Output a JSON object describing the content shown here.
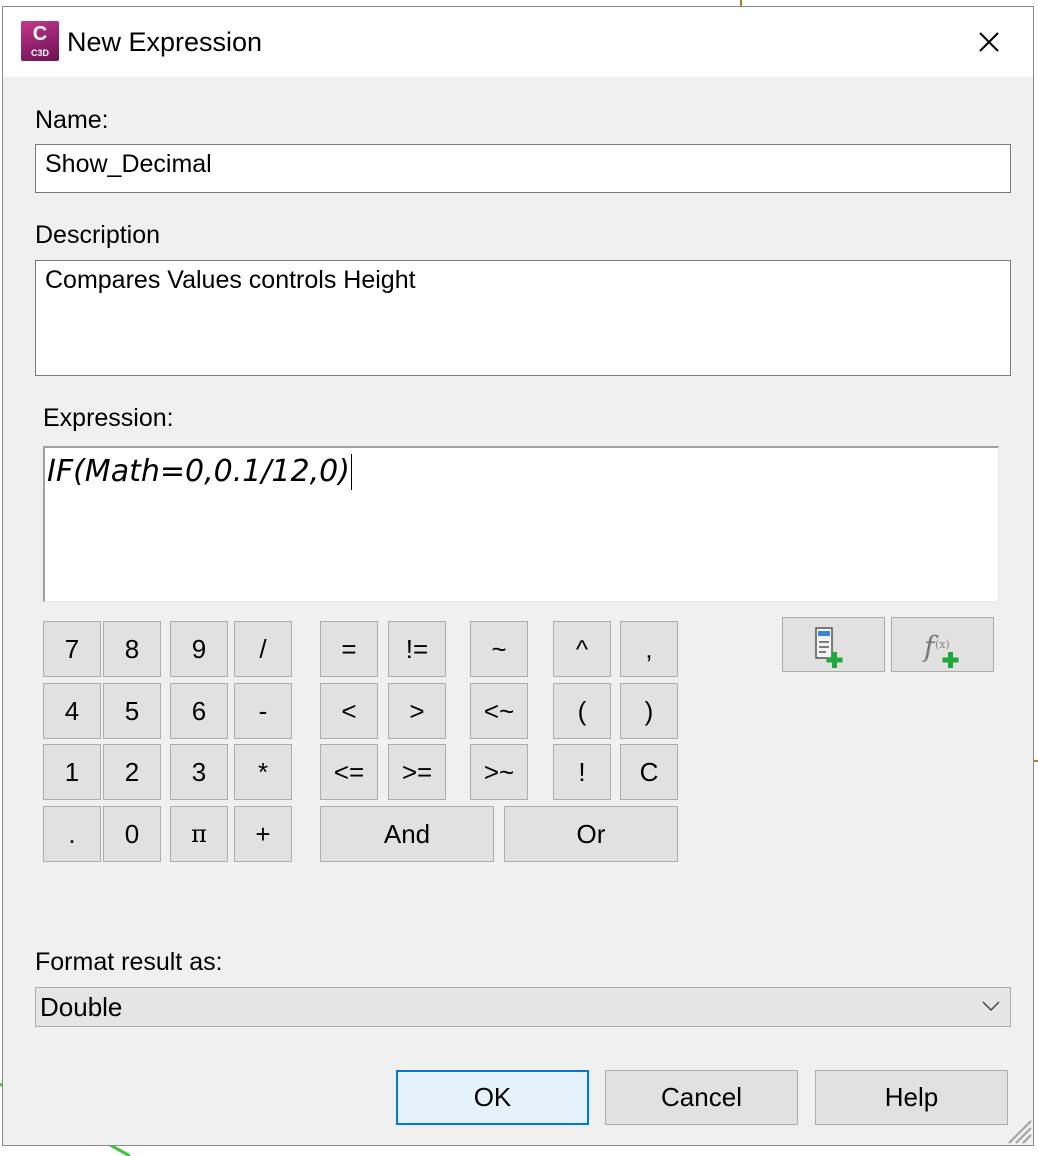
{
  "window": {
    "title": "New Expression",
    "app_icon": {
      "letter": "C",
      "badge": "C3D"
    },
    "close_icon": "close-icon"
  },
  "form": {
    "name_label": "Name:",
    "name_value": "Show_Decimal",
    "description_label": "Description",
    "description_value": "Compares Values controls Height",
    "expression_label": "Expression:",
    "expression_value": "IF(Math=0,0.1/12,0)"
  },
  "keypad": {
    "digits": {
      "k7": "7",
      "k8": "8",
      "k9": "9",
      "kdiv": "/",
      "k4": "4",
      "k5": "5",
      "k6": "6",
      "ksub": "-",
      "k1": "1",
      "k2": "2",
      "k3": "3",
      "kmul": "*",
      "kdot": ".",
      "k0": "0",
      "kpi": "π",
      "kadd": "+"
    },
    "operators": {
      "eq": "=",
      "ne": "!=",
      "approx": "~",
      "pow": "^",
      "comma": ",",
      "lt": "<",
      "gt": ">",
      "ltapprox": "<~",
      "lparen": "(",
      "rparen": ")",
      "le": "<=",
      "ge": ">=",
      "gtapprox": ">~",
      "not": "!",
      "clear": "C",
      "and": "And",
      "or": "Or"
    },
    "tools": {
      "insert_property_icon": "insert-property-icon",
      "insert_function_icon": "insert-function-icon"
    }
  },
  "format": {
    "label": "Format result as:",
    "selected": "Double"
  },
  "actions": {
    "ok": "OK",
    "cancel": "Cancel",
    "help": "Help"
  },
  "colors": {
    "dialog_bg": "#f0f0f0",
    "button_bg": "#e1e1e1",
    "default_button_border": "#0078d7",
    "app_icon": "#a3276f",
    "plus_green": "#1fa83c"
  }
}
